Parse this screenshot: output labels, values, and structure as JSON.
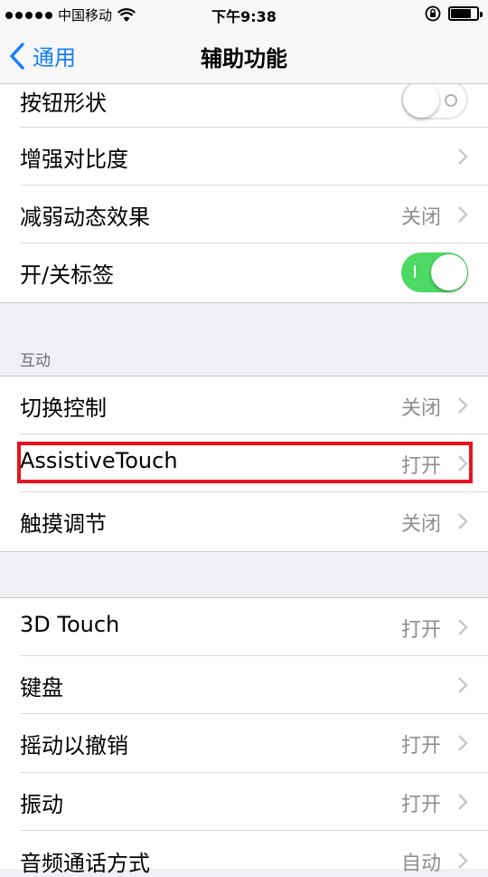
{
  "status_bar": {
    "carrier": "中国移动",
    "time": "下午9:38"
  },
  "nav": {
    "back_label": "通用",
    "title": "辅助功能"
  },
  "rows_group1": [
    {
      "label": "按钮形状",
      "control": "toggle",
      "state": "off"
    },
    {
      "label": "增强对比度",
      "control": "chevron"
    },
    {
      "label": "减弱动态效果",
      "value": "关闭",
      "control": "chevron"
    },
    {
      "label": "开/关标签",
      "control": "toggle",
      "state": "on"
    }
  ],
  "section_interaction": {
    "header": "互动",
    "rows": [
      {
        "label": "切换控制",
        "value": "关闭"
      },
      {
        "label": "AssistiveTouch",
        "value": "打开"
      },
      {
        "label": "触摸调节",
        "value": "关闭"
      }
    ]
  },
  "rows_group3": [
    {
      "label": "3D Touch",
      "value": "打开"
    },
    {
      "label": "键盘",
      "value": ""
    },
    {
      "label": "摇动以撤销",
      "value": "打开"
    },
    {
      "label": "振动",
      "value": "打开"
    },
    {
      "label": "音频通话方式",
      "value": "自动"
    }
  ],
  "colors": {
    "accent": "#157efb",
    "toggle_on": "#4cd964",
    "highlight": "#e8131f"
  }
}
